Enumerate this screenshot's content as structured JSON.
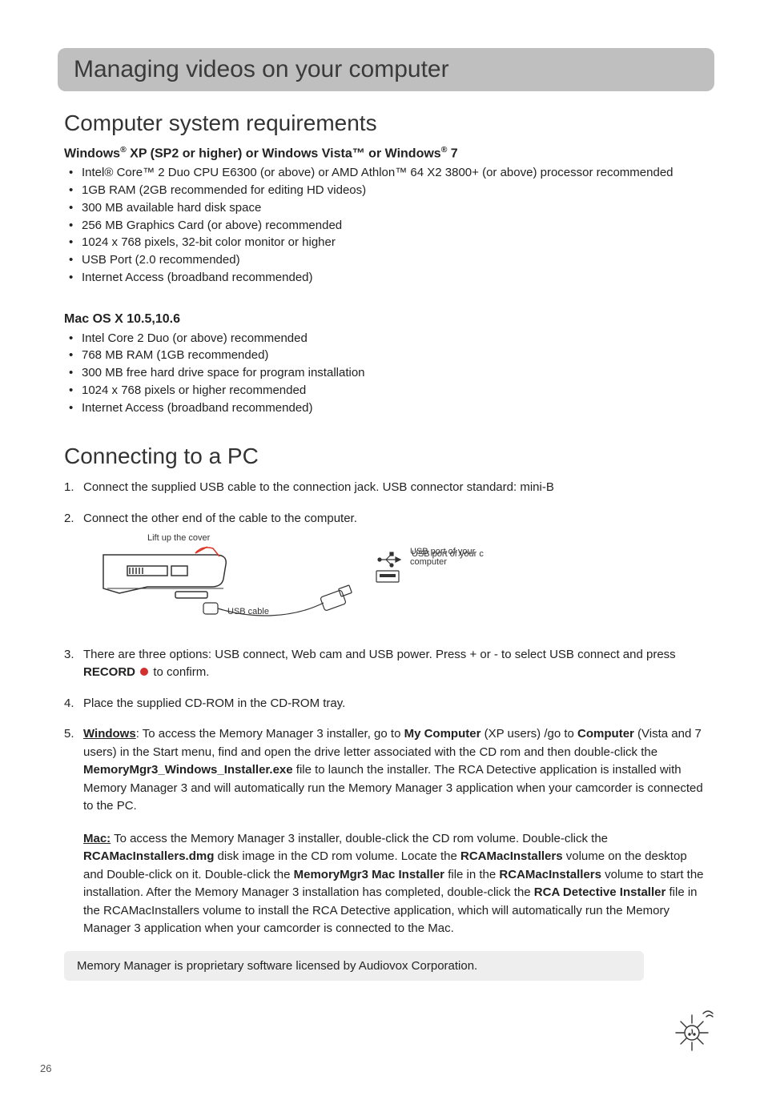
{
  "title_band": "Managing videos on your computer",
  "section1": {
    "heading": "Computer system requirements",
    "win_heading_parts": {
      "p1": "Windows",
      "p2": " XP (SP2 or higher) or Windows Vista™ or Windows",
      "p3": " 7"
    },
    "win_bullets": [
      "Intel® Core™ 2 Duo CPU E6300 (or above) or AMD Athlon™ 64 X2 3800+ (or above) processor recommended",
      "1GB RAM (2GB recommended for editing HD videos)",
      "300 MB available hard disk space",
      "256 MB Graphics Card (or above) recommended",
      "1024 x 768 pixels, 32-bit color monitor or higher",
      "USB Port (2.0 recommended)",
      "Internet Access (broadband recommended)"
    ],
    "mac_heading": "Mac OS X 10.5,10.6",
    "mac_bullets": [
      "Intel Core 2 Duo (or above) recommended",
      "768 MB RAM (1GB recommended)",
      "300 MB free hard drive space for program installation",
      "1024 x 768 pixels or higher recommended",
      "Internet Access (broadband recommended)"
    ]
  },
  "section2": {
    "heading": "Connecting to a PC",
    "step1": "Connect the supplied USB cable to the connection jack. USB connector standard: mini-B",
    "step2": "Connect the other end of the cable to the computer.",
    "diagram": {
      "lift_cover": "Lift up the cover",
      "usb_cable": "USB cable",
      "usb_port": "USB port of your computer"
    },
    "step3_pre": "There are three options: USB connect, Web cam and USB power. Press + or - to select USB connect and press ",
    "step3_record": "RECORD",
    "step3_post": "  to confirm.",
    "step4": "Place the supplied CD-ROM in the CD-ROM tray.",
    "step5": {
      "win_label": "Windows",
      "win_seg1": ": To access the Memory Manager 3 installer, go to ",
      "win_bold1": "My Computer",
      "win_seg2": " (XP users) /go to ",
      "win_bold2": "Computer",
      "win_seg3": " (Vista and 7 users) in the Start menu, find and open the drive letter associated with the CD rom and then double-click the ",
      "win_bold3": "MemoryMgr3_Windows_Installer.exe",
      "win_seg4": " file to launch the installer. The RCA Detective application is installed with Memory Manager 3 and will automatically run the Memory Manager 3 application when your camcorder is connected to the PC.",
      "mac_label": "Mac:",
      "mac_seg1": "  To access the Memory Manager 3 installer, double-click the CD rom volume. Double-click the ",
      "mac_bold1": "RCAMacInstallers.dmg",
      "mac_seg2": " disk image in the CD rom volume. Locate the ",
      "mac_bold2": "RCAMacInstallers",
      "mac_seg3": " volume on the desktop and Double-click on it. Double-click the ",
      "mac_bold3": "MemoryMgr3 Mac Installer",
      "mac_seg4": " file in the ",
      "mac_bold4": "RCAMacInstallers",
      "mac_seg5": " volume to start the installation. After the Memory Manager 3 installation has completed, double-click the ",
      "mac_bold5": "RCA Detective Installer",
      "mac_seg6": " file in the RCAMacInstallers volume to install the RCA Detective application, which will automatically run the Memory Manager 3 application when your camcorder is connected to the Mac."
    }
  },
  "note": "Memory Manager is proprietary software licensed by Audiovox Corporation.",
  "page_number": "26",
  "reg_mark": "®"
}
